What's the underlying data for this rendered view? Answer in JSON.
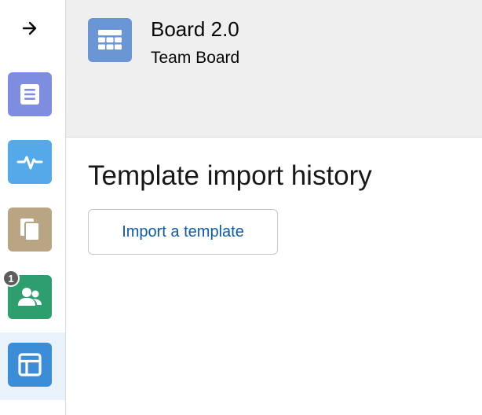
{
  "rail": {
    "toggle_icon": "arrow-right-icon",
    "items": [
      {
        "name": "notes",
        "icon": "list-doc-icon",
        "color": "#7f8de1"
      },
      {
        "name": "activity",
        "icon": "pulse-icon",
        "color": "#54a9e8"
      },
      {
        "name": "files",
        "icon": "copy-docs-icon",
        "color": "#b9a584"
      },
      {
        "name": "people",
        "icon": "group-icon",
        "color": "#2e9e6f",
        "badge": "1"
      },
      {
        "name": "board",
        "icon": "layout-icon",
        "color": "#3a8dd6",
        "active": true
      }
    ]
  },
  "header": {
    "title": "Board 2.0",
    "subtitle": "Team Board",
    "icon": "table-grid-icon",
    "icon_color": "#6a96d6"
  },
  "main": {
    "title": "Template import history",
    "import_button_label": "Import a template"
  },
  "colors": {
    "header_bg": "#efefef",
    "link_blue": "#0b5cab",
    "active_rail_bg": "#e9f2fb"
  }
}
